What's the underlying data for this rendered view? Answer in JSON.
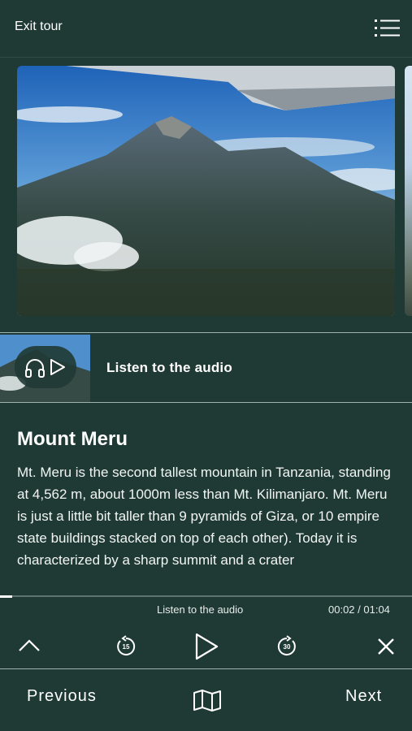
{
  "header": {
    "exit_label": "Exit tour",
    "menu_icon": "list-menu-icon"
  },
  "stop": {
    "title": "Mount Meru",
    "description": "Mt. Meru is the second tallest mountain in Tanzania, standing at 4,562 m, about 1000m less than Mt. Kilimanjaro. Mt. Meru is just a little bit taller than 9 pyramids of Giza, or 10 empire state buildings stacked on top of each other). Today it is characterized by a sharp summit and a crater"
  },
  "audio_card": {
    "label": "Listen to the audio",
    "icons": [
      "headphones-icon",
      "play-icon"
    ]
  },
  "player": {
    "track_title": "Listen to the audio",
    "time": "00:02 / 01:04",
    "progress_fraction": 0.03,
    "rewind_seconds": "15",
    "forward_seconds": "30"
  },
  "footer": {
    "previous_label": "Previous",
    "next_label": "Next",
    "map_icon": "map-icon"
  },
  "colors": {
    "background": "#1f3a34",
    "text": "#ffffff"
  }
}
